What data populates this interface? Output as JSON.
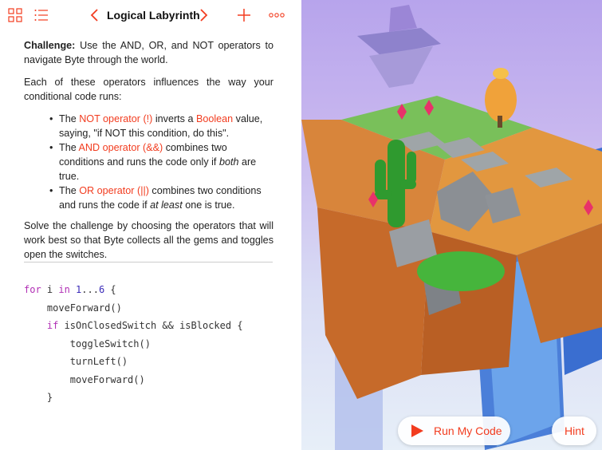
{
  "colors": {
    "accent": "#f23c1f",
    "keyword": "#b12fb5",
    "number": "#3a2bb8"
  },
  "toolbar": {
    "grid_icon": "grid-icon",
    "list_icon": "list-icon",
    "back_icon": "chevron-left-icon",
    "forward_icon": "chevron-right-icon",
    "add_icon": "plus-icon",
    "more_icon": "more-icon",
    "title": "Logical Labyrinth"
  },
  "challenge": {
    "intro_bold": "Challenge:",
    "intro_text": " Use the AND, OR, and NOT operators to navigate Byte through the world.",
    "para2": "Each of these operators influences the way your conditional code runs:",
    "bullets": {
      "not": {
        "pre": "The ",
        "op": "NOT operator (!)",
        "mid": " inverts a ",
        "term": "Boolean",
        "post": " value, saying, \"if NOT this condition, do this\"."
      },
      "and": {
        "pre": "The ",
        "op": "AND operator (&&)",
        "mid": " combines two conditions and runs the code only if ",
        "em": "both",
        "post": " are true."
      },
      "or": {
        "pre": "The ",
        "op": "OR operator (||)",
        "mid": " combines two conditions and runs the code if ",
        "em": "at least",
        "post": " one is true."
      }
    },
    "para3": "Solve the challenge by choosing the operators that will work best so that Byte collects all the gems and toggles open the switches."
  },
  "code": {
    "l1_kw1": "for",
    "l1_var": " i ",
    "l1_kw2": "in",
    "l1_num1": " 1",
    "l1_dots": "...",
    "l1_num2": "6",
    "l1_end": " {",
    "l2": "    moveForward()",
    "l3_indent": "    ",
    "l3_kw": "if",
    "l3_rest": " isOnClosedSwitch && isBlocked {",
    "l4": "        toggleSwitch()",
    "l5": "        turnLeft()",
    "l6": "        moveForward()",
    "l7": "    }"
  },
  "buttons": {
    "run_icon": "play-icon",
    "run_label": "Run My Code",
    "hint_label": "Hint"
  }
}
